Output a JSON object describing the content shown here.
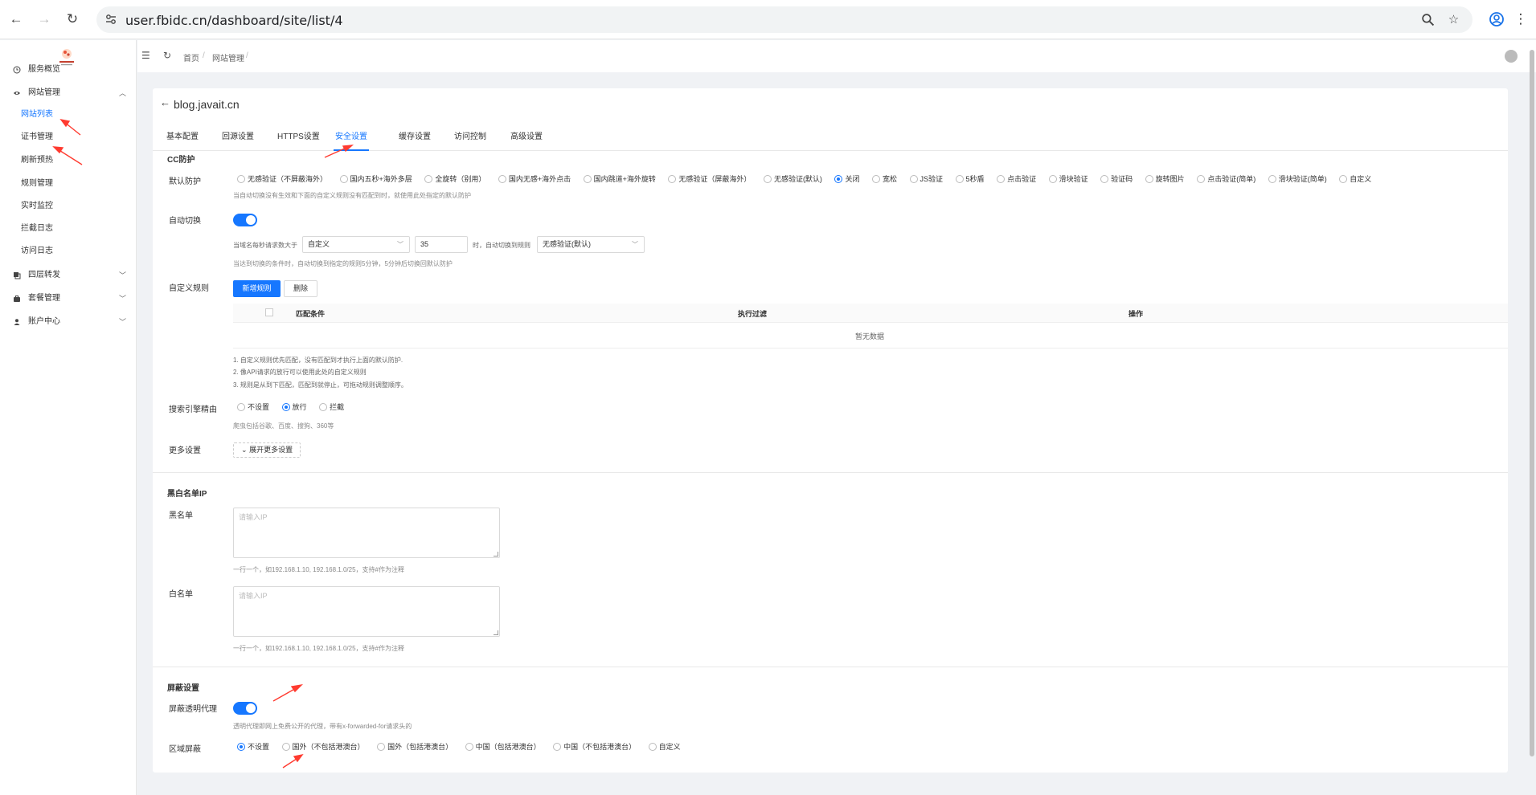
{
  "browser": {
    "url": "user.fbidc.cn/dashboard/site/list/4"
  },
  "sidebar": {
    "items": [
      {
        "label": "服务概览"
      },
      {
        "label": "网站管理"
      },
      {
        "label": "四层转发"
      },
      {
        "label": "套餐管理"
      },
      {
        "label": "账户中心"
      }
    ],
    "sub_items": [
      {
        "label": "网站列表"
      },
      {
        "label": "证书管理"
      },
      {
        "label": "刷新预热"
      },
      {
        "label": "规则管理"
      },
      {
        "label": "实时监控"
      },
      {
        "label": "拦截日志"
      },
      {
        "label": "访问日志"
      }
    ]
  },
  "breadcrumb": [
    "首页",
    "/",
    "网站管理",
    "/"
  ],
  "site": {
    "title": "blog.javait.cn"
  },
  "tabs": [
    "基本配置",
    "回源设置",
    "HTTPS设置",
    "安全设置",
    "缓存设置",
    "访问控制",
    "高级设置"
  ],
  "cc": {
    "section_title": "CC防护",
    "default_label": "默认防护",
    "options": [
      "无感验证（不屏蔽海外）",
      "国内五秒+海外多层",
      "全旋转（别用）",
      "国内无感+海外点击",
      "国内跳道+海外旋转",
      "无感验证（屏蔽海外）",
      "无感验证(默认)",
      "关闭",
      "宽松",
      "JS验证",
      "5秒盾",
      "点击验证",
      "滑块验证",
      "验证码",
      "旋转图片",
      "点击验证(简单)",
      "滑块验证(简单)",
      "自定义"
    ],
    "default_hint": "当自动切换没有生效和下面的自定义规则没有匹配到时，就使用此处指定的默认防护",
    "auto_label": "自动切换",
    "auto_prefix": "当域名每秒请求数大于",
    "auto_select": "自定义",
    "auto_value": "35",
    "auto_middle": "时，自动切换到规则",
    "auto_rule": "无感验证(默认)",
    "auto_hint": "当达到切换的条件时，自动切换到指定的规则5分钟，5分钟后切换回默认防护",
    "custom_label": "自定义规则",
    "add_rule": "新增规则",
    "delete": "删除",
    "columns": [
      "匹配条件",
      "执行过滤",
      "操作"
    ],
    "empty": "暂无数据",
    "notes": [
      "1. 自定义规则优先匹配，没有匹配到才执行上面的默认防护.",
      "2. 像API请求的放行可以使用此处的自定义规则",
      "3. 规则是从到下匹配，匹配到就停止，可拖动规则调整顺序。"
    ],
    "search_label": "搜索引擎精由",
    "search_options": [
      "不设置",
      "放行",
      "拦截"
    ],
    "search_hint": "爬虫包括谷歌、百度、搜狗、360等",
    "more_label": "更多设置",
    "more_btn": "展开更多设置"
  },
  "ip": {
    "section_title": "黑白名单IP",
    "black_label": "黑名单",
    "white_label": "白名单",
    "placeholder": "请输入IP",
    "hint": "一行一个，如192.168.1.10, 192.168.1.0/25，支持#作为注释"
  },
  "block": {
    "section_title": "屏蔽设置",
    "proxy_label": "屏蔽透明代理",
    "proxy_hint": "透明代理即网上免费公开的代理，带有x-forwarded-for请求头的",
    "region_label": "区域屏蔽",
    "region_options": [
      "不设置",
      "国外（不包括港澳台）",
      "国外（包括港澳台）",
      "中国（包括港澳台）",
      "中国（不包括港澳台）",
      "自定义"
    ]
  },
  "colors": {
    "accent": "#1677ff",
    "annotation": "#ff3b30"
  }
}
